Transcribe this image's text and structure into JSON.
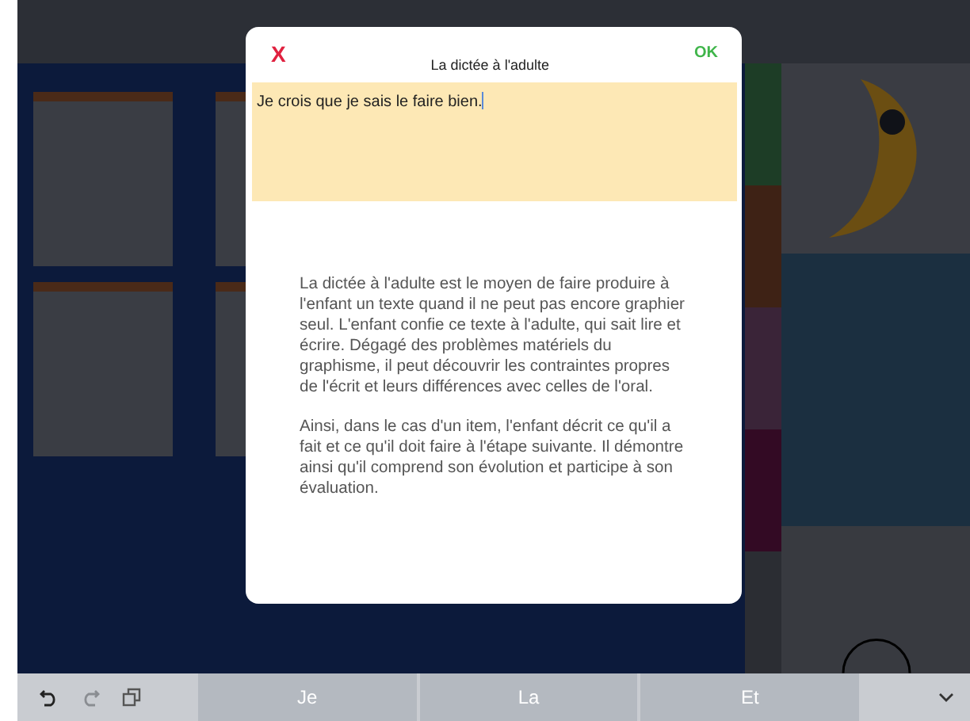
{
  "dialog": {
    "cancel": "X",
    "title": "La dictée à l'adulte",
    "confirm": "OK",
    "answer": "Je crois que je sais le faire bien.",
    "explanation": [
      "La dictée à l'adulte est le moyen de faire produire à l'enfant un texte quand il ne peut pas encore graphier seul. L'enfant confie ce texte à l'adulte, qui sait lire et écrire. Dégagé des problèmes matériels du graphisme, il peut découvrir les contraintes propres de l'écrit et leurs différences avec celles de l'oral.",
      "Ainsi, dans le cas d'un item, l'enfant décrit ce qu'il a fait et ce qu'il doit faire à l'étape suivante. Il démontre ainsi qu'il comprend son évolution et participe à son évaluation."
    ]
  },
  "keyboard_bar": {
    "suggestions": [
      "Je",
      "La",
      "Et"
    ]
  }
}
